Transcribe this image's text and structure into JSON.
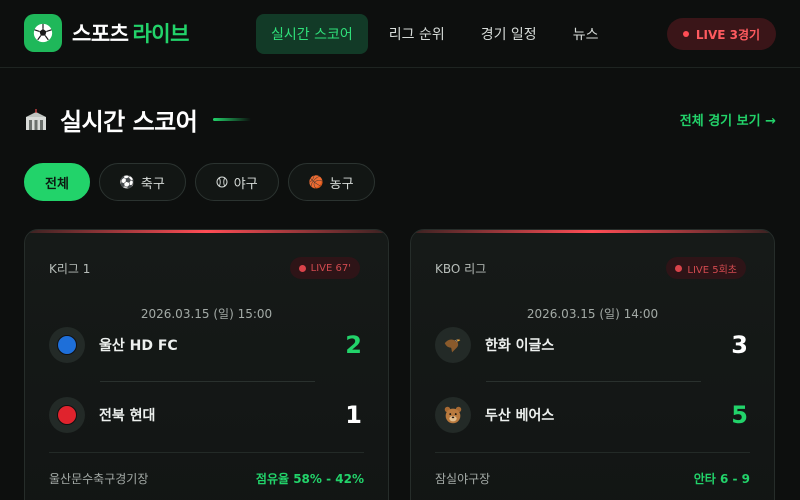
{
  "brand": {
    "name_white": "스포츠",
    "name_green": "라이브",
    "icon": "soccer-ball-icon"
  },
  "nav": {
    "items": [
      {
        "label": "실시간 스코어",
        "active": true
      },
      {
        "label": "리그 순위",
        "active": false
      },
      {
        "label": "경기 일정",
        "active": false
      },
      {
        "label": "뉴스",
        "active": false
      }
    ]
  },
  "header_live": {
    "label": "LIVE 3경기"
  },
  "section": {
    "icon": "stadium-icon",
    "title": "실시간 스코어",
    "view_all": "전체 경기 보기 →"
  },
  "filters": [
    {
      "label": "전체",
      "icon": "",
      "active": true
    },
    {
      "label": "축구",
      "icon": "soccer-icon",
      "active": false
    },
    {
      "label": "야구",
      "icon": "baseball-icon",
      "active": false
    },
    {
      "label": "농구",
      "icon": "basketball-icon",
      "active": false
    }
  ],
  "matches": [
    {
      "league": "K리그 1",
      "live_label": "LIVE 67'",
      "datetime": "2026.03.15 (일) 15:00",
      "home": {
        "name": "울산 HD FC",
        "score": "2",
        "emblem_color": "#1e6fd9",
        "winning": true
      },
      "away": {
        "name": "전북 현대",
        "score": "1",
        "emblem_color": "#e0232d",
        "winning": false
      },
      "venue": "울산문수축구경기장",
      "stat": "점유율 58% - 42%"
    },
    {
      "league": "KBO 리그",
      "live_label": "LIVE 5회초",
      "datetime": "2026.03.15 (일) 14:00",
      "home": {
        "name": "한화 이글스",
        "score": "3",
        "emblem": "eagle-icon",
        "winning": false
      },
      "away": {
        "name": "두산 베어스",
        "score": "5",
        "emblem": "bear-icon",
        "winning": true
      },
      "venue": "잠실야구장",
      "stat": "안타 6 - 9"
    }
  ],
  "colors": {
    "accent": "#22d36a",
    "live": "#ff4d55",
    "background": "#0d0f0e"
  }
}
